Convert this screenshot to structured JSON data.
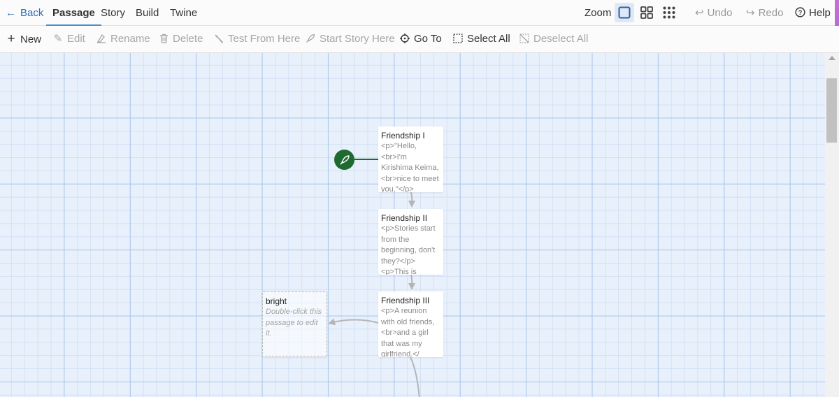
{
  "topbar": {
    "back_label": "Back",
    "tabs": [
      {
        "label": "Passage",
        "active": true
      },
      {
        "label": "Story"
      },
      {
        "label": "Build"
      },
      {
        "label": "Twine"
      }
    ],
    "zoom_label": "Zoom",
    "undo_label": "Undo",
    "redo_label": "Redo",
    "help_label": "Help"
  },
  "toolbar": {
    "new_label": "New",
    "edit_label": "Edit",
    "rename_label": "Rename",
    "delete_label": "Delete",
    "test_label": "Test From Here",
    "start_label": "Start Story Here",
    "goto_label": "Go To",
    "select_all_label": "Select All",
    "deselect_all_label": "Deselect All"
  },
  "passages": [
    {
      "title": "Friendship I",
      "excerpt": "<p>\"Hello,<br>I'm Kirishima Keima,<br>nice to meet you,\"</p><p>That was"
    },
    {
      "title": "Friendship II",
      "excerpt": "<p>Stories start from the beginning, don't they?</p><p>This is"
    },
    {
      "title": "Friendship III",
      "excerpt": "<p>A reunion with old friends,<br>and a girl that was my girlfriend.</"
    },
    {
      "title": "bright",
      "excerpt": "Double-click this passage to edit it."
    }
  ],
  "colors": {
    "accent": "#2f6fb5",
    "grid_background": "#e8f0fb",
    "start_node": "#1e6a31",
    "disabled_text": "#a6a6a6"
  }
}
